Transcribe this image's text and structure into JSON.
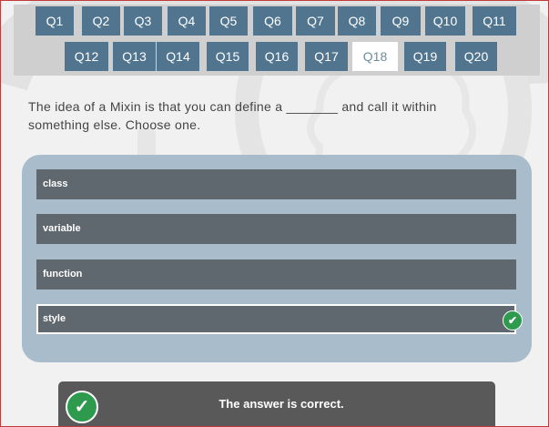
{
  "colors": {
    "nav_button": "#51758f",
    "nav_active_bg": "#ffffff",
    "option_bg": "#5f676f",
    "panel_bg": "#a9bccc",
    "success": "#2e9a4e",
    "result_bg": "#595959"
  },
  "nav": {
    "row1": [
      "Q1",
      "Q2",
      "Q3",
      "Q4",
      "Q5",
      "Q6",
      "Q7",
      "Q8",
      "Q9",
      "Q10",
      "Q11"
    ],
    "row2": [
      "Q12",
      "Q13",
      "Q14",
      "Q15",
      "Q16",
      "Q17",
      "Q18",
      "Q19",
      "Q20"
    ],
    "active": "Q18"
  },
  "question": {
    "text": "The idea of a Mixin is that you can define a _______ and call it within something else. Choose one."
  },
  "options": [
    {
      "label": "class"
    },
    {
      "label": "variable"
    },
    {
      "label": "function"
    },
    {
      "label": "style"
    }
  ],
  "selected_option": "style",
  "result": {
    "icon": "check-circle-icon",
    "text": "The answer is correct."
  }
}
